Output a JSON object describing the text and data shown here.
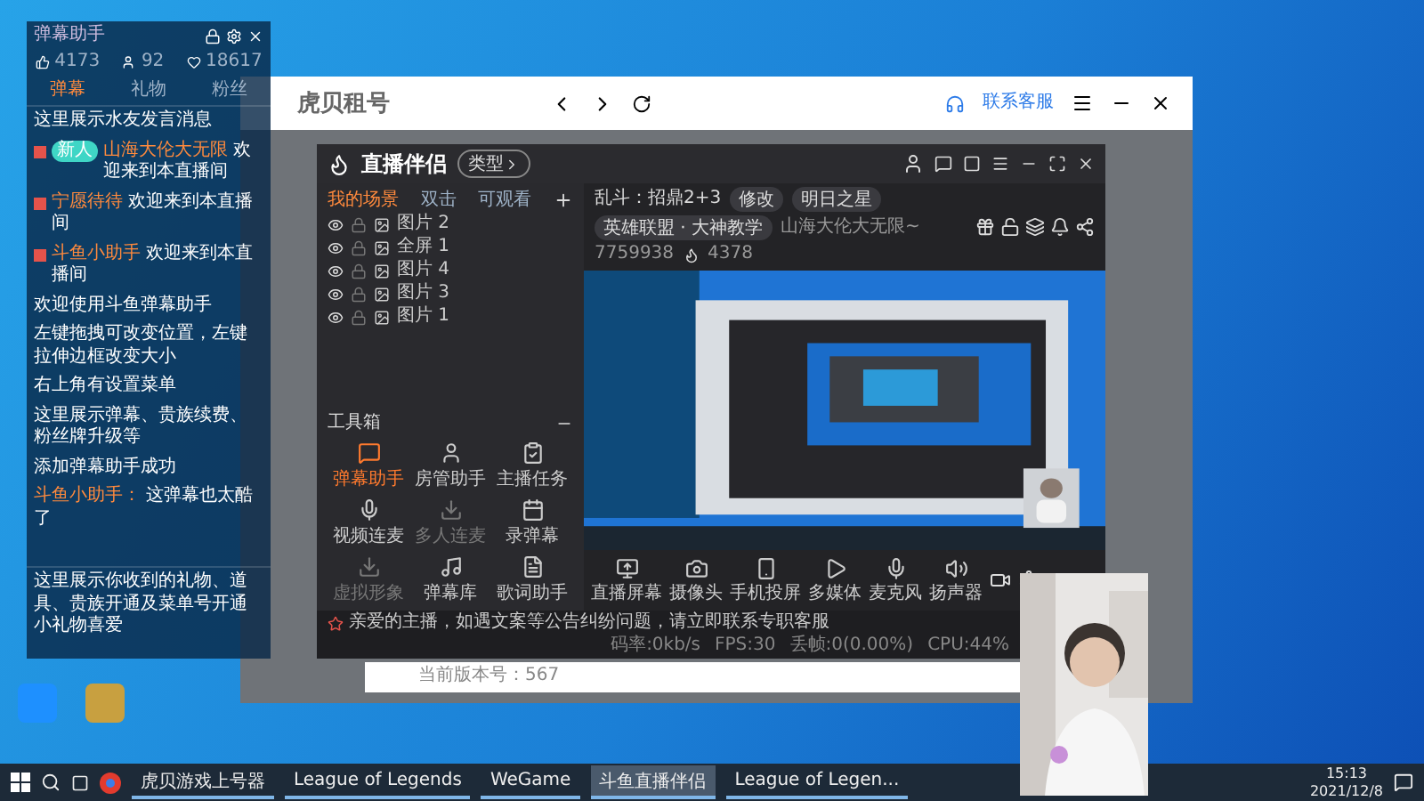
{
  "chat_panel": {
    "title": "弹幕助手",
    "stats": [
      "4173",
      "92",
      "18617"
    ],
    "tabs": [
      {
        "label": "弹幕",
        "selected": true
      },
      {
        "label": "礼物",
        "selected": false
      },
      {
        "label": "粉丝",
        "selected": false
      }
    ],
    "messages": [
      {
        "kind": "system",
        "text": "这里展示水友发言消息"
      },
      {
        "kind": "enter",
        "badge": "新人",
        "name": "山海大伦大无限",
        "text": "欢迎来到本直播间"
      },
      {
        "kind": "enter",
        "name": "宁愿待待",
        "text": "欢迎来到本直播间"
      },
      {
        "kind": "enter",
        "name": "斗鱼小助手",
        "text": "欢迎来到本直播间"
      },
      {
        "kind": "system",
        "text": "欢迎使用斗鱼弹幕助手"
      },
      {
        "kind": "system",
        "text": "左键拖拽可改变位置，左键拉伸边框改变大小"
      },
      {
        "kind": "system",
        "text": "右上角有设置菜单"
      },
      {
        "kind": "system",
        "text": "这里展示弹幕、贵族续费、粉丝牌升级等"
      },
      {
        "kind": "system",
        "text": "添加弹幕助手成功"
      },
      {
        "kind": "chat",
        "name": "斗鱼小助手：",
        "text": "这弹幕也太酷了"
      }
    ],
    "gift_note": "这里展示你收到的礼物、道具、贵族开通及菜单号开通小礼物喜爱"
  },
  "browser": {
    "logo": "虎贝租号",
    "service": "联系客服",
    "version": "当前版本号：567"
  },
  "stream_app": {
    "logo": "直播伴侣",
    "type_button": "类型",
    "tabs": [
      {
        "label": "我的场景",
        "selected": true
      },
      {
        "label": "双击",
        "selected": false
      },
      {
        "label": "可观看",
        "selected": false
      }
    ],
    "sources": [
      {
        "label": "图片 2",
        "visible": true
      },
      {
        "label": "全屏 1",
        "visible": true
      },
      {
        "label": "图片 4",
        "visible": true
      },
      {
        "label": "图片 3",
        "visible": true
      },
      {
        "label": "图片 1",
        "visible": true
      }
    ],
    "room_title": "乱斗：招鼎2+3",
    "edit": "修改",
    "tag": "明日之星",
    "category": "英雄联盟 · 大神教学",
    "host": "山海大伦大无限~",
    "room_id": "7759938",
    "heat": "4378",
    "toolbox": "工具箱",
    "tools": [
      {
        "label": "弹幕助手",
        "selected": true,
        "disabled": false
      },
      {
        "label": "房管助手",
        "selected": false,
        "disabled": false
      },
      {
        "label": "主播任务",
        "selected": false,
        "disabled": false
      },
      {
        "label": "视频连麦",
        "selected": false,
        "disabled": false
      },
      {
        "label": "多人连麦",
        "selected": false,
        "disabled": true
      },
      {
        "label": "录弹幕",
        "selected": false,
        "disabled": false
      },
      {
        "label": "虚拟形象",
        "selected": false,
        "disabled": true
      },
      {
        "label": "弹幕库",
        "selected": false,
        "disabled": false
      },
      {
        "label": "歌词助手",
        "selected": false,
        "disabled": false
      }
    ],
    "controls": [
      "直播屏幕",
      "摄像头",
      "手机投屏",
      "多媒体",
      "麦克风",
      "扬声器"
    ],
    "notice": "亲爱的主播，如遇文案等公告纠纷问题，请立即联系专职客服",
    "stats": [
      "码率:0kb/s",
      "FPS:30",
      "丢帧:0(0.00%)",
      "CPU:44%"
    ]
  },
  "taskbar": {
    "items": [
      {
        "label": "虎贝游戏上号器",
        "selected": false
      },
      {
        "label": "League of Legends",
        "selected": false
      },
      {
        "label": "WeGame",
        "selected": false
      },
      {
        "label": "斗鱼直播伴侣",
        "selected": true
      },
      {
        "label": "League of Legen...",
        "selected": false
      }
    ],
    "time": "15:13",
    "date": "2021/12/8"
  }
}
